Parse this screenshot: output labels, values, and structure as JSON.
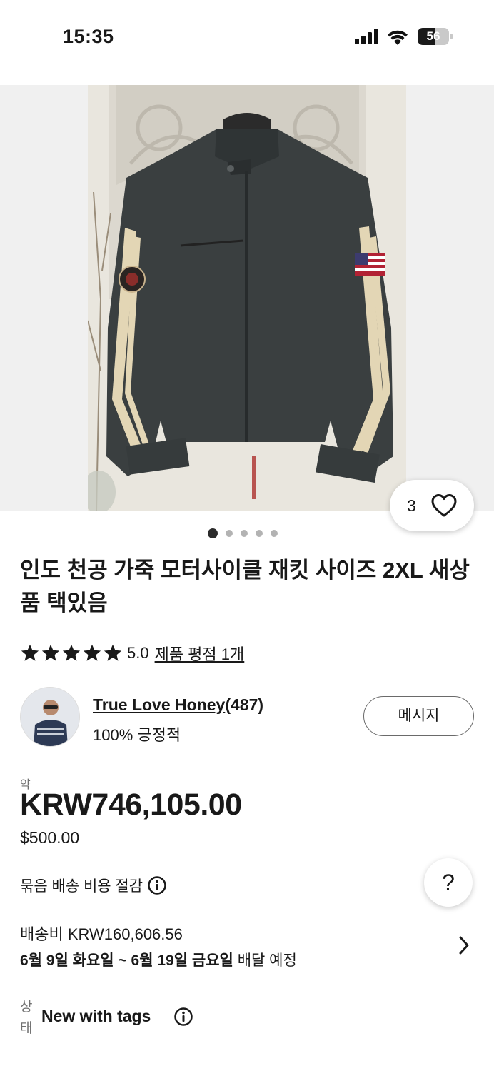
{
  "status_bar": {
    "time": "15:35",
    "battery": "56",
    "icons": [
      "cellular-signal-icon",
      "wifi-icon",
      "battery-icon"
    ]
  },
  "gallery": {
    "total_images": 5,
    "active_index": 0,
    "watch_count": "3",
    "photo_subject": "leather-motorcycle-jacket-photo"
  },
  "listing": {
    "title": "인도 천공 가죽 모터사이클 재킷 사이즈 2XL 새상품 택있음",
    "rating_value": "5.0",
    "rating_stars": 5,
    "rating_link": "제품 평점 1개"
  },
  "seller": {
    "name": "True Love Honey",
    "score": "(487)",
    "feedback": "100% 긍정적",
    "message_label": "메시지"
  },
  "price": {
    "approx_label": "약",
    "main": "KRW746,105.00",
    "usd": "$500.00"
  },
  "shipping": {
    "bundle_label": "묶음 배송 비용 절감",
    "cost": "배송비 KRW160,606.56",
    "delivery_bold": "6월 9일 화요일 ~ 6월 19일 금요일",
    "delivery_suffix": " 배달 예정"
  },
  "condition": {
    "label": "상태",
    "value": "New with tags"
  },
  "help_label": "?",
  "colors": {
    "text": "#191919",
    "secondary": "#707070",
    "star": "#191919"
  }
}
